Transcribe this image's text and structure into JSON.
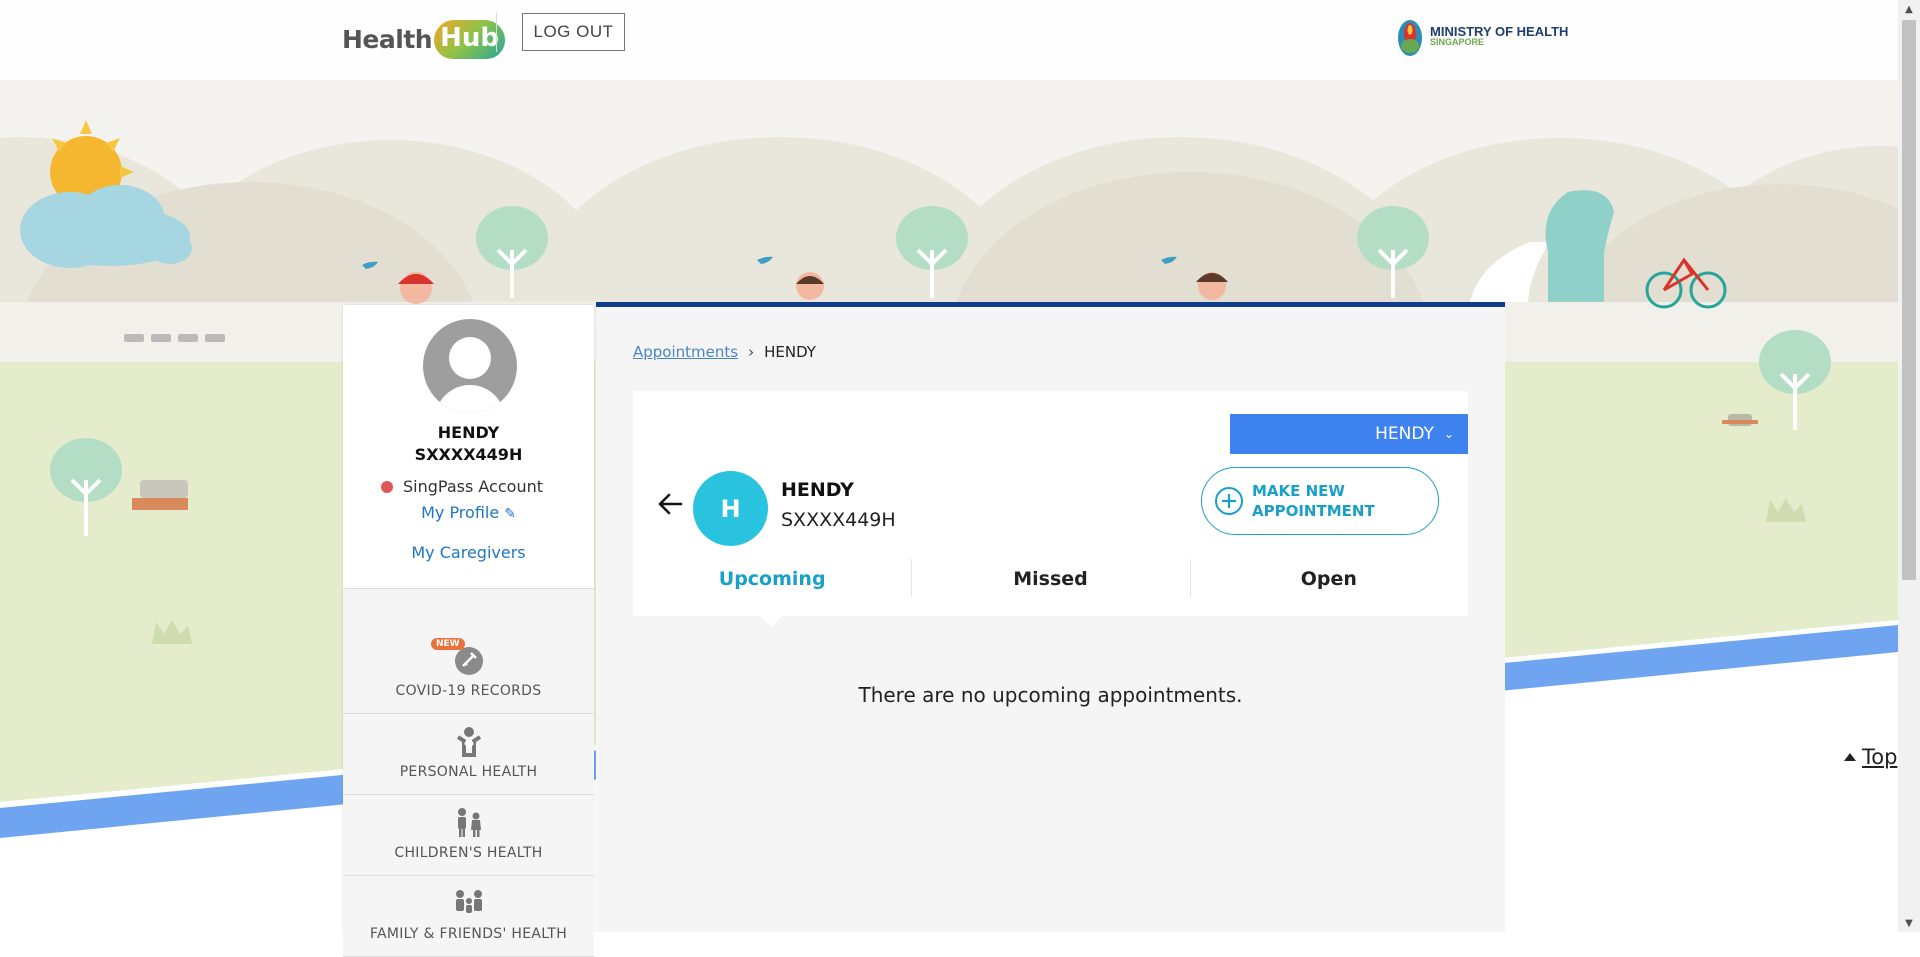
{
  "header": {
    "logo_part1": "Health",
    "logo_part2": "Hub",
    "logout_label": "LOG OUT",
    "ministry_line1": "MINISTRY OF HEALTH",
    "ministry_line2": "SINGAPORE"
  },
  "sidebar": {
    "name": "HENDY",
    "nric": "SXXXX449H",
    "account_type": "SingPass Account",
    "account_status_color": "#e05555",
    "my_profile": "My Profile",
    "my_caregivers": "My Caregivers",
    "new_badge": "NEW",
    "menu": [
      {
        "label": "COVID-19 RECORDS",
        "icon": "vaccine-icon"
      },
      {
        "label": "PERSONAL HEALTH",
        "icon": "person-heart-icon"
      },
      {
        "label": "CHILDREN'S HEALTH",
        "icon": "children-icon"
      },
      {
        "label": "FAMILY & FRIENDS' HEALTH",
        "icon": "family-icon"
      }
    ]
  },
  "main": {
    "breadcrumb": {
      "parent": "Appointments",
      "current": "HENDY"
    },
    "patient_selector": "HENDY",
    "patient": {
      "initial": "H",
      "name": "HENDY",
      "nric": "SXXXX449H"
    },
    "make_appointment_line1": "MAKE NEW",
    "make_appointment_line2": "APPOINTMENT",
    "tabs": [
      {
        "label": "Upcoming",
        "active": true
      },
      {
        "label": "Missed",
        "active": false
      },
      {
        "label": "Open",
        "active": false
      }
    ],
    "empty_message": "There are no upcoming appointments."
  },
  "top_link": "Top",
  "colors": {
    "accent": "#1aa0c8",
    "selector_bg": "#3e82f0",
    "header_border": "#0f3d8a",
    "avatar_bg": "#29c3e0"
  }
}
